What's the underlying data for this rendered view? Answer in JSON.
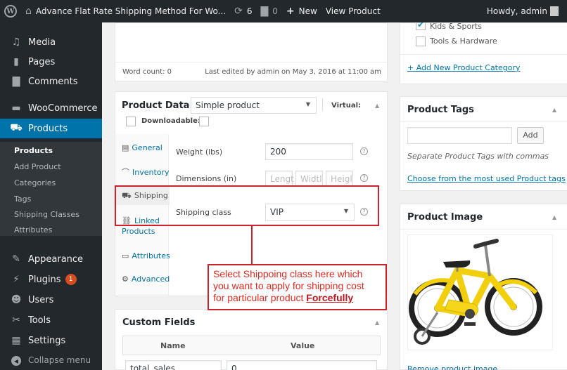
{
  "adminbar": {
    "site_title": "Advance Flat Rate Shipping Method For Wo...",
    "updates_count": "6",
    "comments_count": "0",
    "new_label": "New",
    "view_product_label": "View Product",
    "howdy": "Howdy, admin"
  },
  "sidebar": {
    "media": "Media",
    "pages": "Pages",
    "comments": "Comments",
    "woocommerce": "WooCommerce",
    "products": "Products",
    "submenu": [
      "Products",
      "Add Product",
      "Categories",
      "Tags",
      "Shipping Classes",
      "Attributes"
    ],
    "appearance": "Appearance",
    "plugins": "Plugins",
    "plugins_badge": "1",
    "users": "Users",
    "tools": "Tools",
    "settings": "Settings",
    "collapse": "Collapse menu"
  },
  "editor": {
    "word_count": "Word count: 0",
    "last_edited": "Last edited by admin on May 3, 2016 at 11:00 am"
  },
  "product_data": {
    "title": "Product Data —",
    "type_selected": "Simple product",
    "virtual_label": "Virtual:",
    "downloadable_label": "Downloadable:",
    "tabs": [
      "General",
      "Inventory",
      "Shipping",
      "Linked Products",
      "Attributes",
      "Advanced"
    ],
    "weight_label": "Weight (lbs)",
    "weight_value": "200",
    "dimensions_label": "Dimensions (in)",
    "length_ph": "Lengt",
    "width_ph": "Widtl",
    "height_ph": "Heigl",
    "shipping_class_label": "Shipping class",
    "shipping_class_value": "VIP"
  },
  "annotation": {
    "line1": "Select Shippoing class here which",
    "line2": "you want to apply for shipping cost",
    "line3": "for particular product",
    "emphasis": "Forcefully"
  },
  "custom_fields": {
    "title": "Custom Fields",
    "col_name": "Name",
    "col_value": "Value",
    "row_name": "total_sales",
    "row_value": "0"
  },
  "categories": {
    "items": [
      "Kids & Sports",
      "Tools & Hardware"
    ],
    "add_link": "+ Add New Product Category"
  },
  "tags": {
    "title": "Product Tags",
    "add_button": "Add",
    "hint": "Separate Product Tags with commas",
    "choose_link": "Choose from the most used Product tags"
  },
  "product_image": {
    "title": "Product Image",
    "remove_link": "Remove product image"
  },
  "colors": {
    "adminbar": "#23282d",
    "accent": "#0073aa",
    "annotation": "#d0212a",
    "bike_frame": "#f2cf0c"
  }
}
